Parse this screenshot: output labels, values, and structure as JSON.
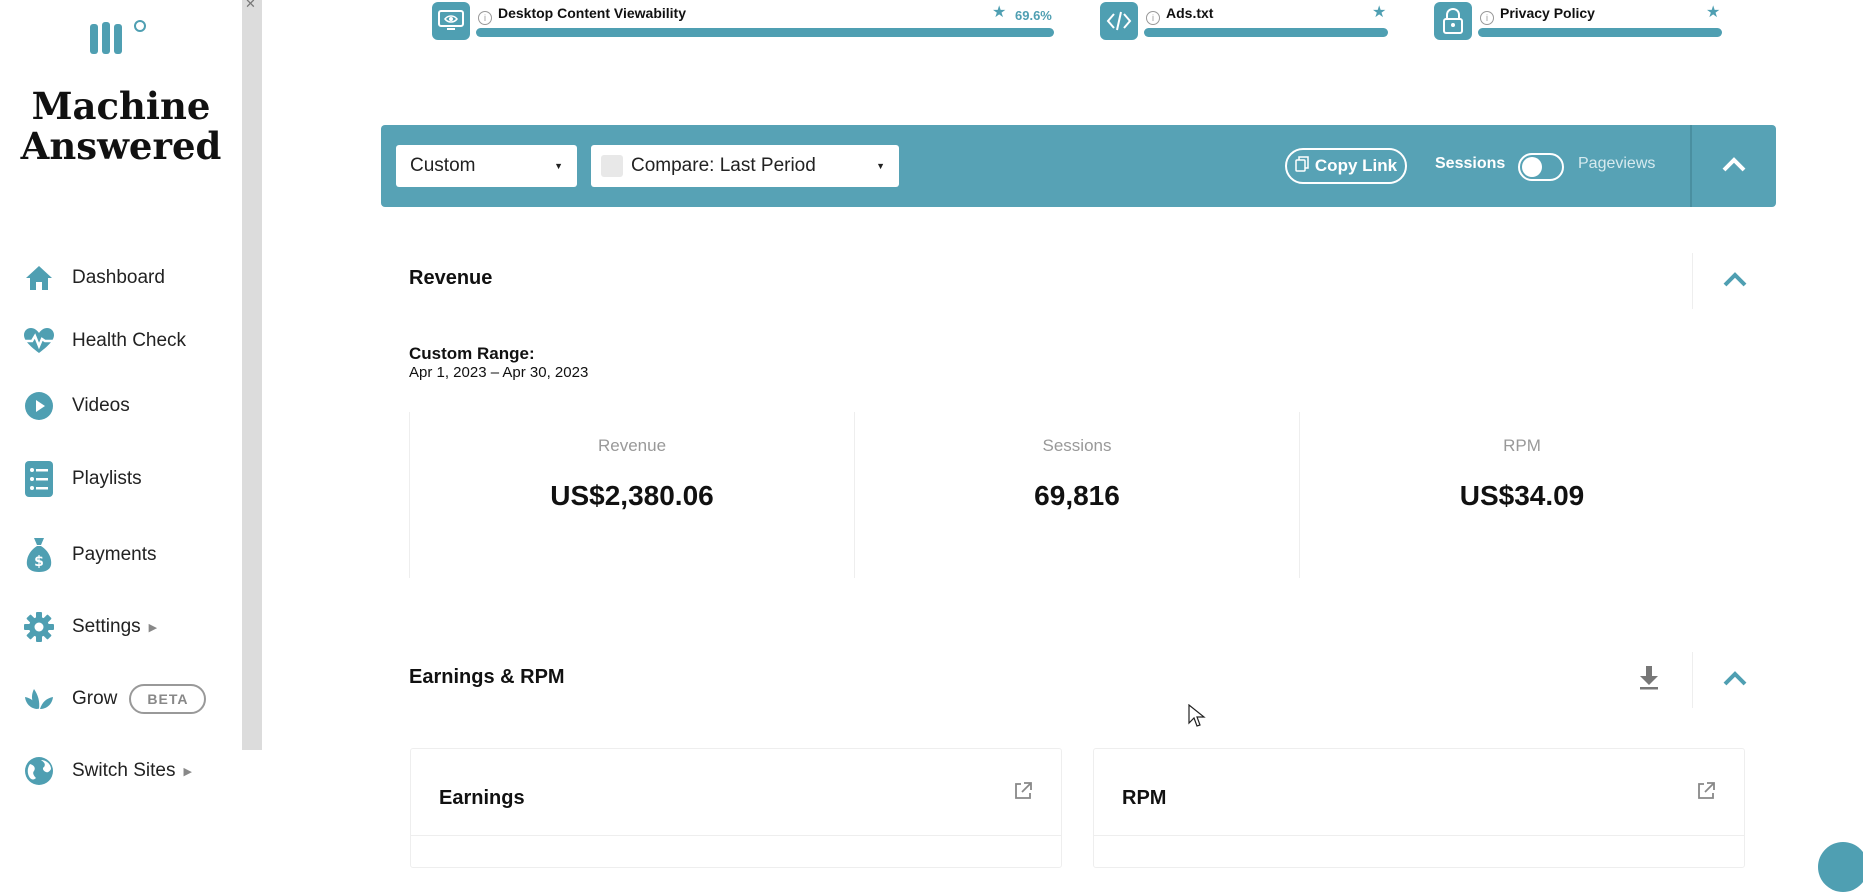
{
  "brand": {
    "name_line1": "Machine",
    "name_line2": "Answered"
  },
  "sidebar": {
    "items": [
      {
        "label": "Dashboard",
        "icon": "home-icon"
      },
      {
        "label": "Health Check",
        "icon": "heartbeat-icon"
      },
      {
        "label": "Videos",
        "icon": "play-icon"
      },
      {
        "label": "Playlists",
        "icon": "list-icon"
      },
      {
        "label": "Payments",
        "icon": "money-bag-icon"
      },
      {
        "label": "Settings",
        "icon": "gear-icon",
        "has_submenu": true
      },
      {
        "label": "Grow",
        "icon": "leaf-icon",
        "badge": "BETA"
      },
      {
        "label": "Switch Sites",
        "icon": "globe-icon",
        "has_submenu": true
      }
    ]
  },
  "metrics": [
    {
      "title": "Desktop Content Viewability",
      "value": "69.6%",
      "icon": "monitor-eye-icon"
    },
    {
      "title": "Ads.txt",
      "icon": "code-icon"
    },
    {
      "title": "Privacy Policy",
      "icon": "lock-icon"
    }
  ],
  "toolbar": {
    "date_range": "Custom",
    "compare": "Compare: Last Period",
    "copy_link": "Copy Link",
    "toggle_left": "Sessions",
    "toggle_right": "Pageviews"
  },
  "revenue_section": {
    "title": "Revenue",
    "range_title": "Custom Range:",
    "range_value": "Apr 1, 2023 – Apr 30, 2023",
    "stats": [
      {
        "label": "Revenue",
        "value": "US$2,380.06"
      },
      {
        "label": "Sessions",
        "value": "69,816"
      },
      {
        "label": "RPM",
        "value": "US$34.09"
      }
    ]
  },
  "earnings_section": {
    "title": "Earnings & RPM",
    "cards": [
      {
        "title": "Earnings"
      },
      {
        "title": "RPM"
      }
    ]
  },
  "colors": {
    "accent": "#57a2b5",
    "icon": "#4f9fb2"
  }
}
